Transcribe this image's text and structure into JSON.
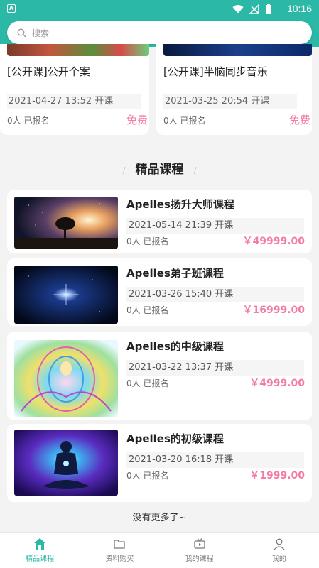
{
  "status_bar": {
    "time": "10:16"
  },
  "search": {
    "placeholder": "搜索"
  },
  "open_courses": [
    {
      "title": "[公开课]公开个案",
      "date": "2021-04-27 13:52 开课",
      "enrolled": "0人 已报名",
      "price": "免费"
    },
    {
      "title": "[公开课]半脑同步音乐",
      "date": "2021-03-25 20:54 开课",
      "enrolled": "0人 已报名",
      "price": "免费"
    }
  ],
  "section": {
    "title": "精品课程",
    "slash": "/"
  },
  "courses": [
    {
      "name": "Apelles扬升大师课程",
      "date": "2021-05-14 21:39 开课",
      "enrolled": "0人 已报名",
      "price": "￥49999.00"
    },
    {
      "name": "Apelles弟子班课程",
      "date": "2021-03-26 15:40 开课",
      "enrolled": "0人 已报名",
      "price": "￥16999.00"
    },
    {
      "name": "Apelles的中级课程",
      "date": "2021-03-22 13:37 开课",
      "enrolled": "0人 已报名",
      "price": "￥4999.00"
    },
    {
      "name": "Apelles的初级课程",
      "date": "2021-03-20 16:18 开课",
      "enrolled": "0人 已报名",
      "price": "￥1999.00"
    }
  ],
  "footer": {
    "no_more": "没有更多了~"
  },
  "tabbar": {
    "tabs": [
      {
        "label": "精品课程",
        "icon": "home-icon",
        "active": true
      },
      {
        "label": "资料购买",
        "icon": "folder-icon",
        "active": false
      },
      {
        "label": "我的课程",
        "icon": "tv-icon",
        "active": false
      },
      {
        "label": "我的",
        "icon": "user-icon",
        "active": false
      }
    ]
  },
  "colors": {
    "accent": "#2bb8a7",
    "price": "#f27da0",
    "background": "#f3f3f3"
  }
}
